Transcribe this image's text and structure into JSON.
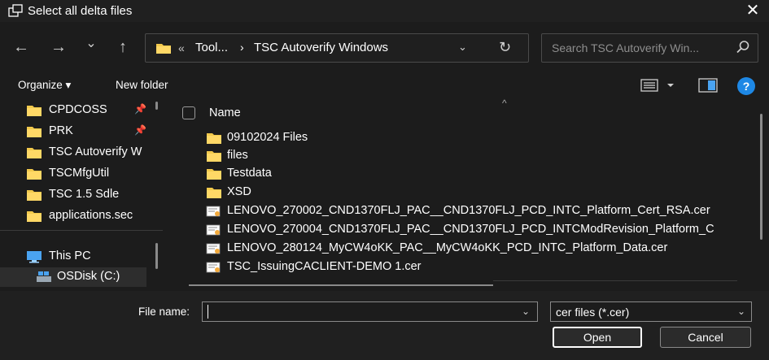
{
  "window": {
    "title": "Select all delta files",
    "close_glyph": "✕"
  },
  "nav": {
    "back_glyph": "←",
    "forward_glyph": "→",
    "recent_glyph": "⌄",
    "up_glyph": "↑"
  },
  "address": {
    "prefix": "«",
    "segments": [
      "Tool...",
      "TSC Autoverify Windows"
    ],
    "separator": "›",
    "dropdown_glyph": "⌄",
    "refresh_glyph": "↻"
  },
  "search": {
    "placeholder": "Search TSC Autoverify Win...",
    "icon": "search-icon"
  },
  "toolbar": {
    "organize_label": "Organize ▾",
    "new_folder_label": "New folder"
  },
  "sidebar": {
    "quick_access": [
      {
        "label": "CPDCOSS",
        "pinned": true
      },
      {
        "label": "PRK",
        "pinned": true
      },
      {
        "label": "TSC Autoverify W",
        "pinned": false
      },
      {
        "label": "TSCMfgUtil",
        "pinned": false
      },
      {
        "label": "TSC 1.5 Sdle",
        "pinned": false
      },
      {
        "label": "applications.sec",
        "pinned": false
      }
    ],
    "this_pc_label": "This PC",
    "drive_label": "OSDisk (C:)"
  },
  "filelist": {
    "column_name": "Name",
    "sort_glyph": "^",
    "items": [
      {
        "name": "09102024 Files",
        "type": "folder"
      },
      {
        "name": "files",
        "type": "folder"
      },
      {
        "name": "Testdata",
        "type": "folder"
      },
      {
        "name": "XSD",
        "type": "folder"
      },
      {
        "name": "LENOVO_270002_CND1370FLJ_PAC__CND1370FLJ_PCD_INTC_Platform_Cert_RSA.cer",
        "type": "cert"
      },
      {
        "name": "LENOVO_270004_CND1370FLJ_PAC__CND1370FLJ_PCD_INTCModRevision_Platform_C",
        "type": "cert"
      },
      {
        "name": "LENOVO_280124_MyCW4oKK_PAC__MyCW4oKK_PCD_INTC_Platform_Data.cer",
        "type": "cert"
      },
      {
        "name": "TSC_IssuingCACLIENT-DEMO 1.cer",
        "type": "cert"
      }
    ]
  },
  "footer": {
    "file_name_label": "File name:",
    "file_name_value": "",
    "file_type_value": "cer files (*.cer)",
    "open_label": "Open",
    "cancel_label": "Cancel"
  },
  "colors": {
    "background": "#1c1c1c",
    "folder": "#f2c94c",
    "accent": "#1e88e5"
  }
}
